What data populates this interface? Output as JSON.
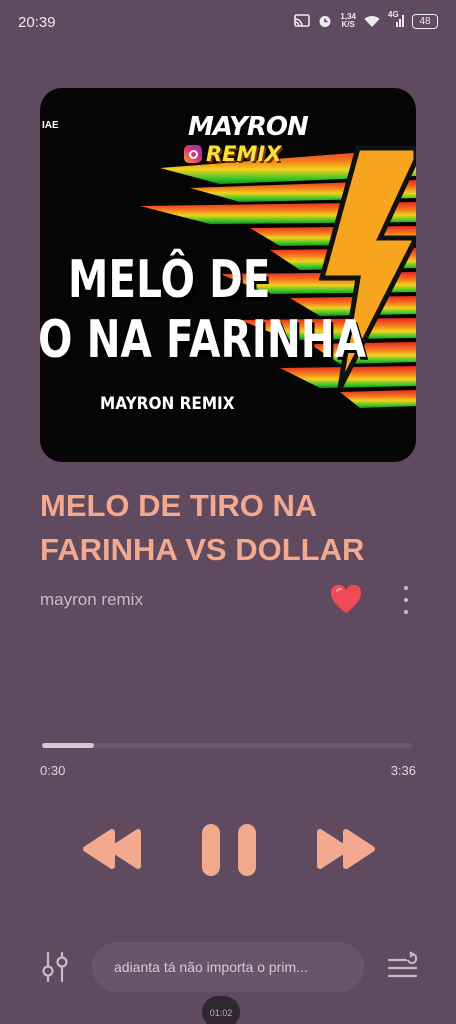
{
  "status_bar": {
    "time": "20:39",
    "net_speed_value": "1,34",
    "net_speed_unit": "K/S",
    "signal_label": "4G",
    "battery": "48",
    "icons": [
      "cast-icon",
      "alarm-icon",
      "wifi-icon",
      "signal-icon",
      "battery-icon"
    ]
  },
  "album_art": {
    "corner_text": "IAE",
    "brand_top": "MAYRON",
    "brand_bottom": "REMIX",
    "line1": "MELÔ DE",
    "line2": "O NA FARINHA",
    "subtitle": "MAYRON REMIX"
  },
  "track": {
    "title": "MELO DE TIRO NA FARINHA VS DOLLAR",
    "artist": "mayron remix",
    "liked": true
  },
  "progress": {
    "current": "0:30",
    "total": "3:36",
    "fraction": 0.14
  },
  "controls": {
    "icons": [
      "rewind-icon",
      "pause-icon",
      "fast-forward-icon"
    ]
  },
  "bottom": {
    "lyrics_line": "adianta tá não importa o prim...",
    "clock": "01:02"
  },
  "colors": {
    "background": "#5f4a5f",
    "accent": "#f2a98e",
    "heart": "#f04a55"
  }
}
